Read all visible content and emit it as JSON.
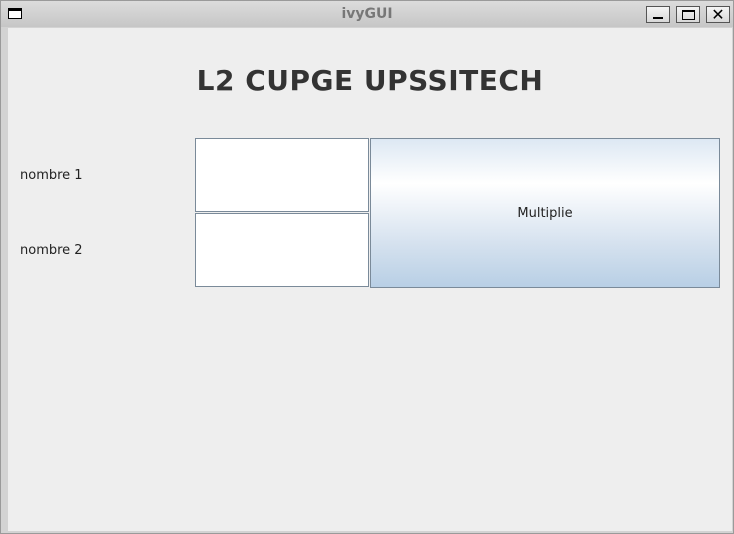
{
  "window": {
    "title": "ivyGUI",
    "controls": [
      "minimize",
      "maximize",
      "close"
    ]
  },
  "main": {
    "heading": "L2 CUPGE UPSSITECH",
    "fields": [
      {
        "label": "nombre 1",
        "value": ""
      },
      {
        "label": "nombre 2",
        "value": ""
      }
    ],
    "button_label": "Multiplie"
  },
  "colors": {
    "window_bg": "#eeeeee",
    "titlebar": "#d0d0d0",
    "button_gradient_top": "#ffffff",
    "button_gradient_bottom": "#b8cfe5"
  },
  "icons": {
    "window_menu": "window-menu-icon",
    "minimize": "minimize-icon",
    "maximize": "maximize-icon",
    "close": "close-icon"
  }
}
